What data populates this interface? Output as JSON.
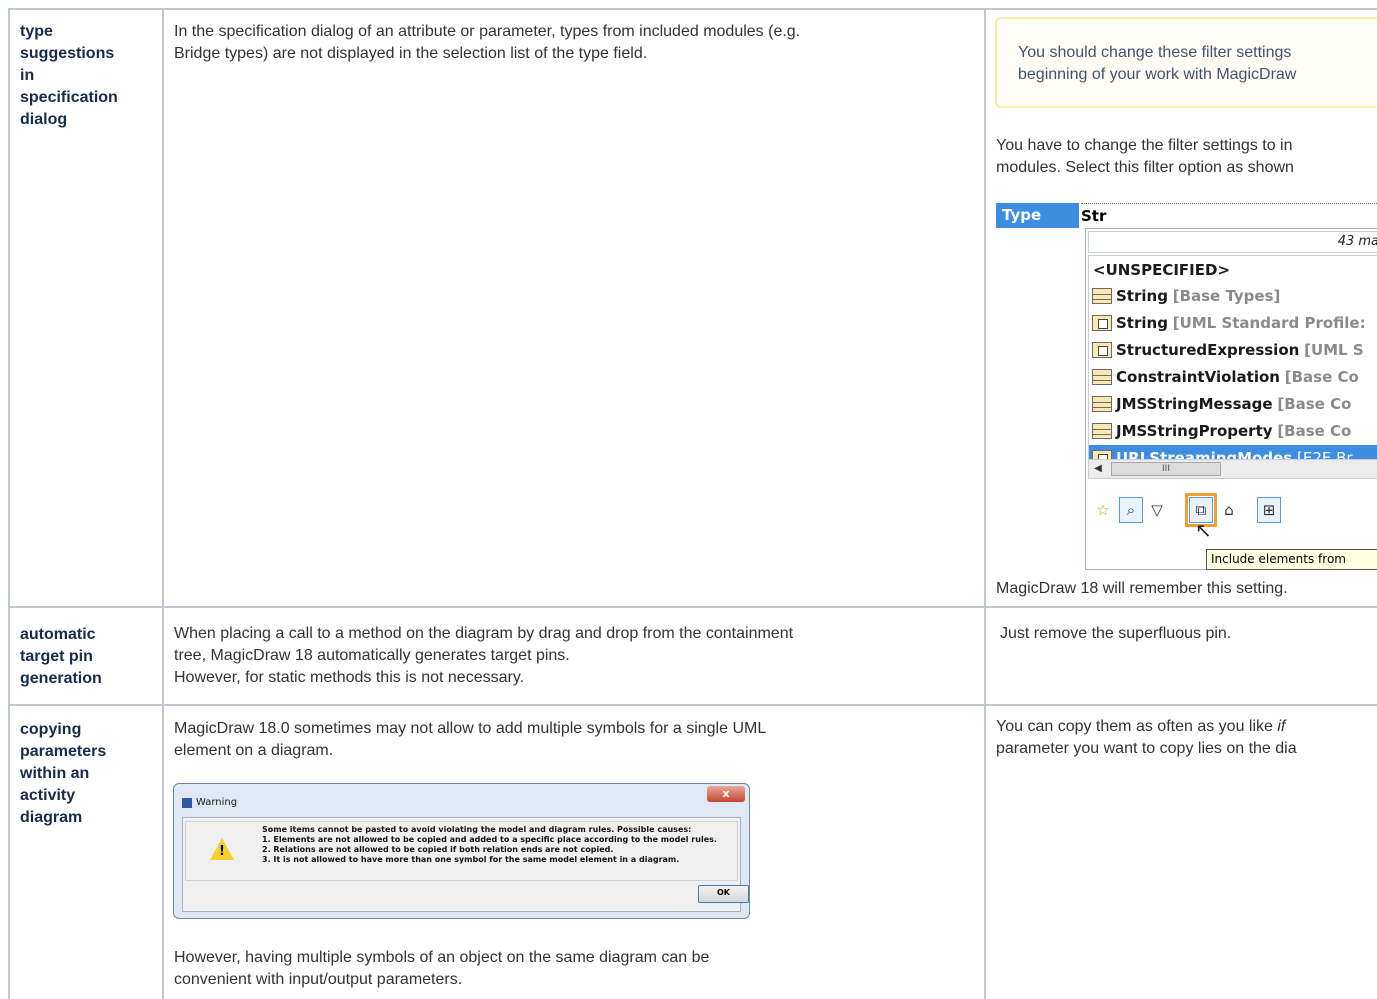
{
  "rows": [
    {
      "term_lines": [
        "type",
        "suggestions",
        "in",
        "specification",
        "dialog"
      ],
      "description_lines": [
        "In the specification dialog of an attribute or parameter, types from included modules (e.g.",
        "Bridge types) are not displayed in the selection list of the type field."
      ],
      "note_lines": [
        "You should change these filter settings",
        "beginning of your work with MagicDraw"
      ],
      "solution_lines": [
        "You have to change the filter settings to in",
        "modules. Select this filter option as shown"
      ],
      "footer": "MagicDraw 18 will remember this setting."
    },
    {
      "term_lines": [
        "automatic",
        "target pin",
        "generation"
      ],
      "description_lines": [
        "When placing a call to a method on the diagram by drag and drop from the containment",
        "tree, MagicDraw 18 automatically generates target pins.",
        "However, for static methods this is not necessary."
      ],
      "solution_lines": [
        "Just remove the superfluous pin."
      ]
    },
    {
      "term_lines": [
        "copying",
        "parameters",
        "within an",
        "activity",
        "diagram"
      ],
      "description_lines": [
        "MagicDraw 18.0 sometimes may not allow to add multiple symbols for a single UML",
        "element on a diagram."
      ],
      "after_lines": [
        "However, having multiple symbols of an object on the same diagram can be",
        "convenient  with input/output parameters."
      ],
      "solution_line1_prefix": "You can copy them as often as you like ",
      "solution_line1_italic": "if",
      "solution_line2": "parameter you want to copy lies on the dia"
    }
  ],
  "type_selector": {
    "label": "Type",
    "value": "Str",
    "count_text": "43 ma",
    "items": [
      {
        "name": "<UNSPECIFIED>",
        "source": "",
        "icon": "none"
      },
      {
        "name": "String",
        "source": "[Base Types]",
        "icon": "class-icon"
      },
      {
        "name": "String",
        "source": "[UML Standard Profile:",
        "icon": "stereotype-icon"
      },
      {
        "name": "StructuredExpression",
        "source": "[UML S",
        "icon": "stereotype-icon"
      },
      {
        "name": "ConstraintViolation",
        "source": "[Base Co",
        "icon": "class-icon"
      },
      {
        "name": "JMSStringMessage",
        "source": "[Base Co",
        "icon": "class-icon"
      },
      {
        "name": "JMSStringProperty",
        "source": "[Base Co",
        "icon": "class-icon"
      },
      {
        "name": "URLStreamingModes",
        "source": "[E2E Br",
        "icon": "stereotype-icon"
      }
    ],
    "scroll_thumb": "III",
    "tooltip": "Include elements from",
    "toolbar_icons": [
      "star-icon",
      "search-details-icon",
      "filter-icon",
      "include-modules-icon",
      "home-icon",
      "expand-icon"
    ]
  },
  "warning_dialog": {
    "title": "Warning",
    "close": "x",
    "message_lines": [
      "Some items cannot be pasted to avoid violating the model and diagram rules. Possible causes:",
      "1. Elements are not allowed to be copied and added to a specific place according to the model rules.",
      "2. Relations are not allowed to be copied if both relation ends are not copied.",
      "3. It is not allowed to have more than one symbol for the same model element in a diagram."
    ],
    "ok_label": "OK"
  }
}
